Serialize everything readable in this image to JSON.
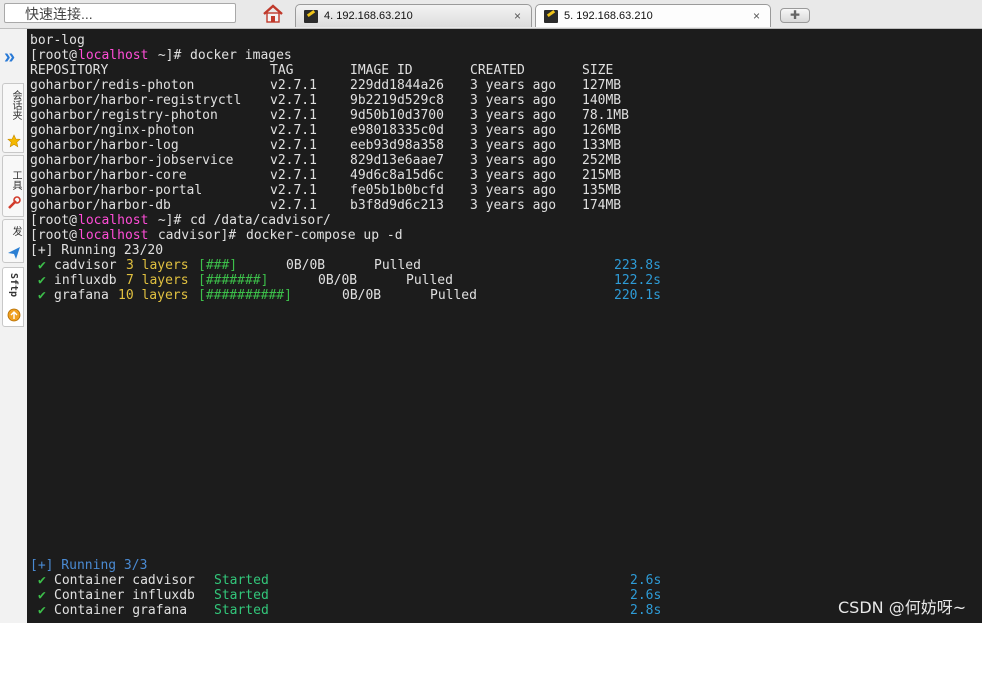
{
  "toolbar": {
    "quick_connect_placeholder": "快速连接...",
    "tabs": [
      {
        "label": "4. 192.168.63.210",
        "active": false,
        "close": "×"
      },
      {
        "label": "5. 192.168.63.210",
        "active": true,
        "close": "×"
      }
    ],
    "new_tab_symbol": "✚"
  },
  "sidebar": {
    "arrow": "»",
    "items": [
      {
        "label": "会话夹",
        "icon": "star-icon"
      },
      {
        "label": "工具",
        "icon": "tools-icon"
      },
      {
        "label": "发",
        "icon": "send-icon"
      },
      {
        "label": "Sftp",
        "icon": "sftp-icon"
      }
    ]
  },
  "terminal": {
    "prompt": {
      "user": "[root@",
      "host": "localhost",
      "home_dir": " ~]# ",
      "cadvisor_dir": " cadvisor]# "
    },
    "first_line": "bor-log",
    "cmd_images": "docker images",
    "images_headers": {
      "repository": "REPOSITORY",
      "tag": "TAG",
      "image_id": "IMAGE ID",
      "created": "CREATED",
      "size": "SIZE"
    },
    "images": [
      {
        "repository": "goharbor/redis-photon",
        "tag": "v2.7.1",
        "image_id": "229dd1844a26",
        "created": "3 years ago",
        "size": "127MB"
      },
      {
        "repository": "goharbor/harbor-registryctl",
        "tag": "v2.7.1",
        "image_id": "9b2219d529c8",
        "created": "3 years ago",
        "size": "140MB"
      },
      {
        "repository": "goharbor/registry-photon",
        "tag": "v2.7.1",
        "image_id": "9d50b10d3700",
        "created": "3 years ago",
        "size": "78.1MB"
      },
      {
        "repository": "goharbor/nginx-photon",
        "tag": "v2.7.1",
        "image_id": "e98018335c0d",
        "created": "3 years ago",
        "size": "126MB"
      },
      {
        "repository": "goharbor/harbor-log",
        "tag": "v2.7.1",
        "image_id": "eeb93d98a358",
        "created": "3 years ago",
        "size": "133MB"
      },
      {
        "repository": "goharbor/harbor-jobservice",
        "tag": "v2.7.1",
        "image_id": "829d13e6aae7",
        "created": "3 years ago",
        "size": "252MB"
      },
      {
        "repository": "goharbor/harbor-core",
        "tag": "v2.7.1",
        "image_id": "49d6c8a15d6c",
        "created": "3 years ago",
        "size": "215MB"
      },
      {
        "repository": "goharbor/harbor-portal",
        "tag": "v2.7.1",
        "image_id": "fe05b1b0bcfd",
        "created": "3 years ago",
        "size": "135MB"
      },
      {
        "repository": "goharbor/harbor-db",
        "tag": "v2.7.1",
        "image_id": "b3f8d9d6c213",
        "created": "3 years ago",
        "size": "174MB"
      }
    ],
    "cmd_cd": "cd /data/cadvisor/",
    "cmd_compose": "docker-compose up -d",
    "running_pull": "[+] Running 23/20",
    "pulls": [
      {
        "check": "✔",
        "name": "cadvisor",
        "layers": "3 layers",
        "bar": "[###]",
        "progress": "0B/0B",
        "status": "Pulled",
        "time": "223.8s"
      },
      {
        "check": "✔",
        "name": "influxdb",
        "layers": "7 layers",
        "bar": "[#######]",
        "progress": "0B/0B",
        "status": "Pulled",
        "time": "122.2s"
      },
      {
        "check": "✔",
        "name": "grafana",
        "layers": "10 layers",
        "bar": "[##########]",
        "progress": "0B/0B",
        "status": "Pulled",
        "time": "220.1s"
      }
    ],
    "running_containers": "[+] Running 3/3",
    "containers": [
      {
        "check": "✔",
        "label": "Container cadvisor",
        "status": "Started",
        "time": "2.6s"
      },
      {
        "check": "✔",
        "label": "Container influxdb",
        "status": "Started",
        "time": "2.6s"
      },
      {
        "check": "✔",
        "label": "Container grafana",
        "status": "Started",
        "time": "2.8s"
      }
    ]
  },
  "watermark": "CSDN @何妨呀~"
}
